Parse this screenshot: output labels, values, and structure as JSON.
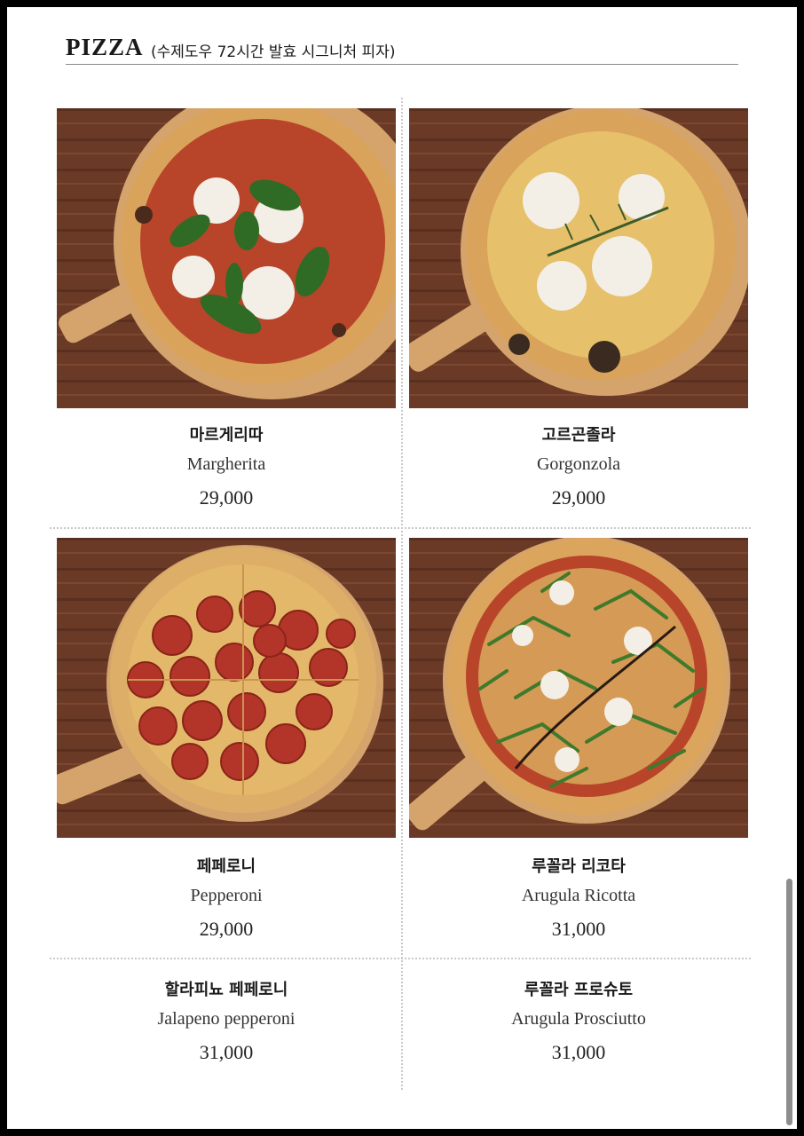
{
  "header": {
    "title": "PIZZA",
    "subtitle": "(수제도우 72시간 발효 시그니처 피자)"
  },
  "items": [
    {
      "name_kr": "마르게리따",
      "name_en": "Margherita",
      "price": "29,000"
    },
    {
      "name_kr": "고르곤졸라",
      "name_en": "Gorgonzola",
      "price": "29,000"
    },
    {
      "name_kr": "페페로니",
      "name_en": "Pepperoni",
      "price": "29,000"
    },
    {
      "name_kr": "루꼴라 리코타",
      "name_en": "Arugula Ricotta",
      "price": "31,000"
    },
    {
      "name_kr": "할라피뇨 페페로니",
      "name_en": "Jalapeno pepperoni",
      "price": "31,000"
    },
    {
      "name_kr": "루꼴라  프로슈토",
      "name_en": "Arugula Prosciutto",
      "price": "31,000"
    }
  ],
  "colors": {
    "wood_table": "#6b3a26",
    "wood_board": "#d4a46c",
    "crust": "#d9a35c",
    "tomato": "#b8452a",
    "basil": "#2f6b24",
    "cheese": "#f3efe6",
    "pepperoni": "#b3352a",
    "arugula": "#3f7a2c"
  }
}
